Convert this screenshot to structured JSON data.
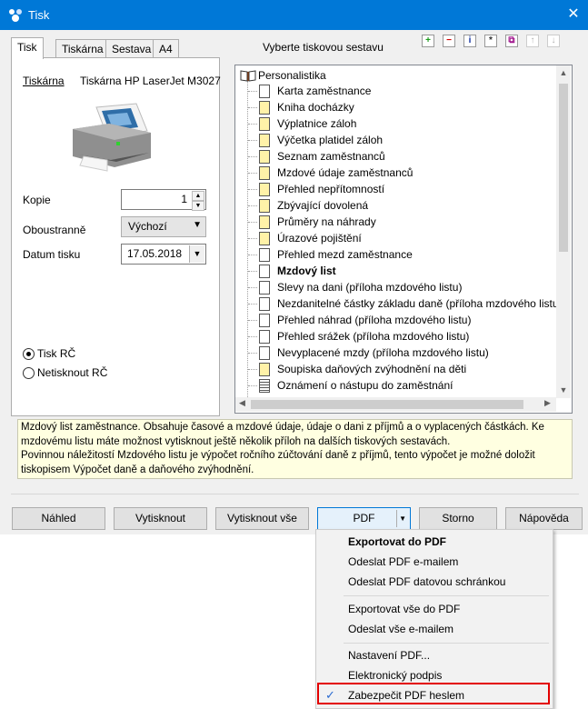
{
  "window": {
    "title": "Tisk",
    "close_label": "✕"
  },
  "tabs": [
    "Tisk",
    "Tiskárna",
    "Sestava",
    "A4"
  ],
  "tree_header": "Vyberte tiskovou sestavu",
  "printer": {
    "label": "Tiskárna",
    "name": "Tiskárna HP LaserJet M3027"
  },
  "copies": {
    "label": "Kopie",
    "value": "1"
  },
  "duplex": {
    "label": "Oboustranně",
    "value": "Výchozí"
  },
  "date": {
    "label": "Datum tisku",
    "value": "17.05.2018"
  },
  "radios": [
    {
      "label": "Tisk RČ",
      "selected": true
    },
    {
      "label": "Netisknout RČ",
      "selected": false
    }
  ],
  "toolbar_icons": [
    "add-icon",
    "remove-icon",
    "info-icon",
    "star-icon",
    "copy-icon",
    "move-up-icon",
    "move-down-icon"
  ],
  "tree": {
    "root": "Personalistika",
    "items": [
      {
        "label": "Karta zaměstnance",
        "color": "white"
      },
      {
        "label": "Kniha docházky",
        "color": "yellow"
      },
      {
        "label": "Výplatnice záloh",
        "color": "yellow"
      },
      {
        "label": "Výčetka platidel záloh",
        "color": "yellow"
      },
      {
        "label": "Seznam zaměstnanců",
        "color": "yellow"
      },
      {
        "label": "Mzdové údaje zaměstnanců",
        "color": "yellow"
      },
      {
        "label": "Přehled nepřítomností",
        "color": "yellow"
      },
      {
        "label": "Zbývající dovolená",
        "color": "yellow"
      },
      {
        "label": "Průměry na náhrady",
        "color": "yellow"
      },
      {
        "label": "Úrazové pojištění",
        "color": "yellow"
      },
      {
        "label": "Přehled mezd zaměstnance",
        "color": "white"
      },
      {
        "label": "Mzdový list",
        "color": "white",
        "bold": true
      },
      {
        "label": "Slevy na dani (příloha mzdového listu)",
        "color": "white"
      },
      {
        "label": "Nezdanitelné částky základu daně (příloha mzdového listu)",
        "color": "white"
      },
      {
        "label": "Přehled náhrad (příloha mzdového listu)",
        "color": "white"
      },
      {
        "label": "Přehled srážek (příloha mzdového listu)",
        "color": "white"
      },
      {
        "label": "Nevyplacené mzdy (příloha mzdového listu)",
        "color": "white"
      },
      {
        "label": "Soupiska daňových zvýhodnění na děti",
        "color": "yellow"
      },
      {
        "label": "Oznámení o nástupu do zaměstnání",
        "color": "lined"
      }
    ]
  },
  "description": {
    "para1": "Mzdový list zaměstnance. Obsahuje časové a mzdové údaje, údaje o dani z příjmů a o vyplacených částkách. Ke mzdovému listu máte možnost vytisknout ještě několik příloh na dalších tiskových sestavách.",
    "para2": "Povinnou náležitostí Mzdového listu je výpočet ročního zúčtování daně z příjmů, tento výpočet je možné doložit tiskopisem Výpočet daně a daňového zvýhodnění."
  },
  "buttons": {
    "preview": "Náhled",
    "print": "Vytisknout",
    "print_all": "Vytisknout vše",
    "pdf": "PDF",
    "cancel": "Storno",
    "help": "Nápověda"
  },
  "pdf_menu": {
    "items": [
      {
        "label": "Exportovat do PDF",
        "bold": true
      },
      {
        "label": "Odeslat PDF e-mailem"
      },
      {
        "label": "Odeslat PDF datovou schránkou"
      },
      {
        "label": "Exportovat vše do PDF"
      },
      {
        "label": "Odeslat vše e-mailem"
      },
      {
        "label": "Nastavení PDF..."
      },
      {
        "label": "Elektronický podpis"
      },
      {
        "label": "Zabezpečit PDF heslem",
        "checked": true
      }
    ]
  },
  "colors": {
    "titlebar": "#0078d7",
    "highlight": "#e30000",
    "doc_yellow": "#fff2a8"
  }
}
